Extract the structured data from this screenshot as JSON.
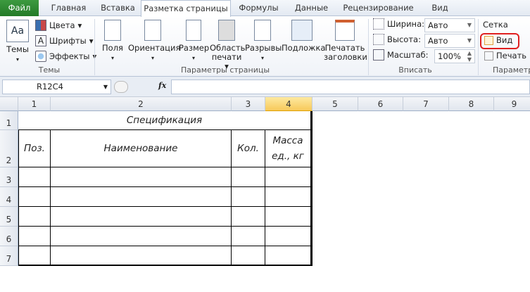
{
  "tabs": [
    "Файл",
    "Главная",
    "Вставка",
    "Разметка страницы",
    "Формулы",
    "Данные",
    "Рецензирование",
    "Вид"
  ],
  "ribbon": {
    "themes": {
      "themes_label": "Темы",
      "colors": "Цвета",
      "fonts": "Шрифты",
      "effects": "Эффекты",
      "group": "Темы"
    },
    "page_setup": {
      "margins": "Поля",
      "orientation": "Ориентация",
      "size": "Размер",
      "print_area_1": "Область",
      "print_area_2": "печати",
      "breaks": "Разрывы",
      "background": "Подложка",
      "print_titles_1": "Печатать",
      "print_titles_2": "заголовки",
      "group": "Параметры страницы"
    },
    "scale": {
      "width_label": "Ширина:",
      "width_value": "Авто",
      "height_label": "Высота:",
      "height_value": "Авто",
      "scale_label": "Масштаб:",
      "scale_value": "100%",
      "group": "Вписать"
    },
    "sheet_options": {
      "gridlines": "Сетка",
      "view": "Вид",
      "view_checked": false,
      "print": "Печать",
      "print_checked": false,
      "group": "Параметр",
      "highlight_color": "#e02020"
    }
  },
  "formula_bar": {
    "name_box": "R12C4",
    "fx": "fx",
    "formula": ""
  },
  "columns": [
    "1",
    "2",
    "3",
    "4",
    "5",
    "6",
    "7",
    "8",
    "9"
  ],
  "rows": [
    "1",
    "2",
    "3",
    "4",
    "5",
    "6",
    "7"
  ],
  "table": {
    "title": "Спецификация",
    "headers": [
      "Поз.",
      "Наименование",
      "Кол.",
      "Масса ед., кг"
    ]
  }
}
